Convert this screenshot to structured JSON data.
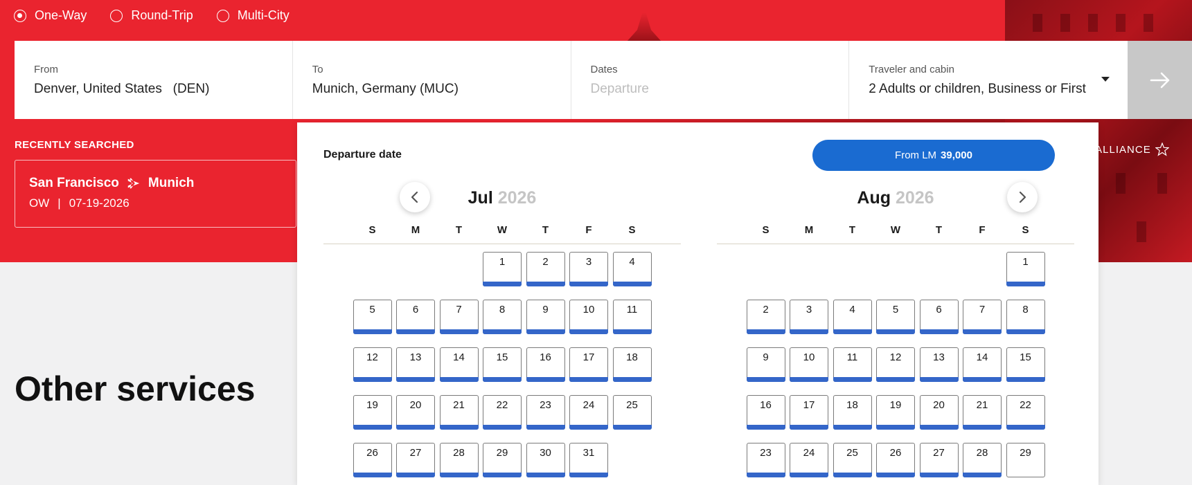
{
  "trip_types": [
    {
      "label": "One-Way",
      "checked": true
    },
    {
      "label": "Round-Trip",
      "checked": false
    },
    {
      "label": "Multi-City",
      "checked": false
    }
  ],
  "search": {
    "from": {
      "label": "From",
      "value": "Denver, United States   (DEN)"
    },
    "to": {
      "label": "To",
      "value": "Munich, Germany (MUC)"
    },
    "dates": {
      "label": "Dates",
      "placeholder": "Departure"
    },
    "traveler": {
      "label": "Traveler and cabin",
      "value": "2 Adults or children, Business or First"
    }
  },
  "recent": {
    "title": "RECENTLY SEARCHED",
    "origin": "San Francisco",
    "destination": "Munich",
    "trip": "OW",
    "separator": "|",
    "date": "07-19-2026"
  },
  "alliance_text": "R ALLIANCE",
  "other_services": "Other services",
  "calendar": {
    "heading": "Departure date",
    "price_prefix": "From LM",
    "price_value": "39,000",
    "weekdays": [
      "S",
      "M",
      "T",
      "W",
      "T",
      "F",
      "S"
    ],
    "months": [
      {
        "name": "Jul",
        "year": "2026",
        "offset": 3,
        "days": 31,
        "unavailable": []
      },
      {
        "name": "Aug",
        "year": "2026",
        "offset": 6,
        "days": 29,
        "unavailable": [
          29
        ]
      }
    ]
  },
  "colors": {
    "brand_red": "#ea242f",
    "accent_blue": "#1a6bd1",
    "avail_bar": "#3466c9"
  }
}
